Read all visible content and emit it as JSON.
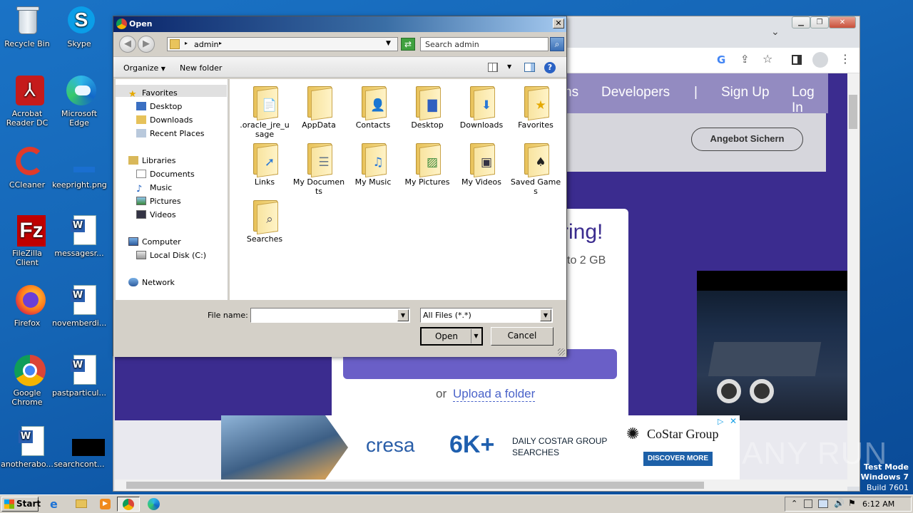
{
  "desktop": {
    "icons": [
      {
        "label": "Recycle Bin"
      },
      {
        "label": "Skype"
      },
      {
        "label": "Acrobat Reader DC"
      },
      {
        "label": "Microsoft Edge"
      },
      {
        "label": "CCleaner"
      },
      {
        "label": "keepright.png"
      },
      {
        "label": "FileZilla Client"
      },
      {
        "label": "messagesr..."
      },
      {
        "label": "Firefox"
      },
      {
        "label": "novemberdi..."
      },
      {
        "label": "Google Chrome"
      },
      {
        "label": "pastparticul..."
      },
      {
        "label": "anotherabo..."
      },
      {
        "label": "searchcont..."
      }
    ],
    "watermark": {
      "brand": "ANY RUN",
      "line1": "Test Mode",
      "line2": "Windows 7",
      "line3": "Build 7601"
    }
  },
  "browser": {
    "nav": {
      "item_partial": "ns",
      "developers": "Developers",
      "separator": "|",
      "sign_up": "Sign Up",
      "log_in": "Log In"
    },
    "promo_button": "Angebot Sichern",
    "hero_heading_partial": "ring!",
    "hero_sub_partial": "to 2 GB",
    "or_text": "or",
    "upload_folder_link": "Upload a folder",
    "ad": {
      "brand": "cresa",
      "big_number": "6K+",
      "line1": "DAILY COSTAR GROUP",
      "line2": "SEARCHES",
      "advertiser": "CoStar Group",
      "cta": "DISCOVER MORE"
    }
  },
  "dialog": {
    "title": "Open",
    "close_glyph": "✕",
    "address_current": "admin",
    "search_placeholder": "Search admin",
    "toolbar": {
      "organize": "Organize",
      "new_folder": "New folder"
    },
    "nav_pane": {
      "favorites_header": "Favorites",
      "favorites": [
        "Desktop",
        "Downloads",
        "Recent Places"
      ],
      "libraries_header": "Libraries",
      "libraries": [
        "Documents",
        "Music",
        "Pictures",
        "Videos"
      ],
      "computer_header": "Computer",
      "drives": [
        "Local Disk (C:)"
      ],
      "network_header": "Network"
    },
    "items": [
      {
        "label": ".oracle_jre_usage",
        "icon": "doc-folder-icon"
      },
      {
        "label": "AppData",
        "icon": "folder-icon"
      },
      {
        "label": "Contacts",
        "icon": "contacts-folder-icon"
      },
      {
        "label": "Desktop",
        "icon": "desktop-folder-icon"
      },
      {
        "label": "Downloads",
        "icon": "downloads-folder-icon"
      },
      {
        "label": "Favorites",
        "icon": "favorites-folder-icon"
      },
      {
        "label": "Links",
        "icon": "links-folder-icon"
      },
      {
        "label": "My Documents",
        "icon": "documents-folder-icon"
      },
      {
        "label": "My Music",
        "icon": "music-folder-icon"
      },
      {
        "label": "My Pictures",
        "icon": "pictures-folder-icon"
      },
      {
        "label": "My Videos",
        "icon": "videos-folder-icon"
      },
      {
        "label": "Saved Games",
        "icon": "games-folder-icon"
      },
      {
        "label": "Searches",
        "icon": "searches-folder-icon"
      }
    ],
    "file_name_label": "File name:",
    "file_name_value": "",
    "file_type": "All Files (*.*)",
    "open_button": "Open",
    "cancel_button": "Cancel"
  },
  "taskbar": {
    "start": "Start",
    "clock": "6:12 AM"
  }
}
